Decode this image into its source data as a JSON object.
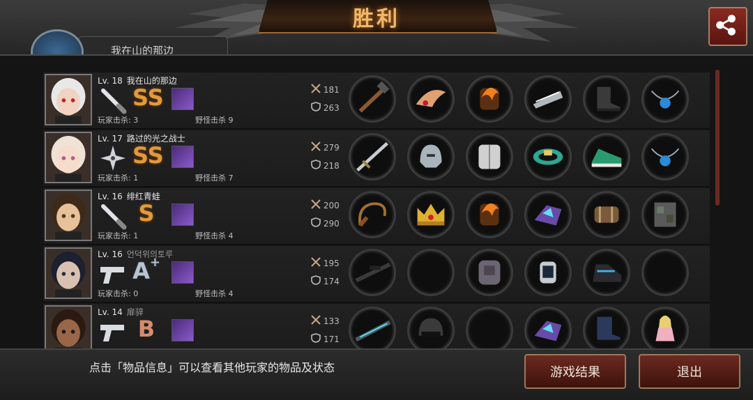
{
  "header": {
    "title": "胜利",
    "player_tab_label": "我在山的那边"
  },
  "footer": {
    "hint": "点击「物品信息」可以查看其他玩家的物品及状态",
    "result_button": "游戏结果",
    "exit_button": "退出"
  },
  "players": [
    {
      "level": "Lv. 18",
      "name": "我在山的那边",
      "grade": "SS",
      "player_kills": "玩家击杀: 3",
      "monster_kills": "野怪击杀 9",
      "attack": "181",
      "defense": "263",
      "weapon_icon": "baseball-bat-icon",
      "items": [
        "hammer",
        "wing-crown",
        "fire-armor",
        "blade-bracer",
        "boots",
        "pendant"
      ]
    },
    {
      "level": "Lv. 17",
      "name": "路过的光之战士",
      "grade": "SS",
      "player_kills": "玩家击杀: 1",
      "monster_kills": "野怪击杀 7",
      "attack": "279",
      "defense": "218",
      "weapon_icon": "shuriken-icon",
      "items": [
        "sword",
        "helmet",
        "plate-armor",
        "bracelet",
        "sneakers",
        "pendant"
      ]
    },
    {
      "level": "Lv. 16",
      "name": "绯红青蛙",
      "grade": "S",
      "player_kills": "玩家击杀: 1",
      "monster_kills": "野怪击杀 4",
      "attack": "200",
      "defense": "290",
      "weapon_icon": "baseball-bat-icon",
      "items": [
        "whip",
        "crown",
        "fire-armor",
        "crystal-gauntlet",
        "scroll-bracer",
        "ruin-block"
      ]
    },
    {
      "level": "Lv. 16",
      "name": "언덕위의토루",
      "grade": "A",
      "grade_sup": "+",
      "player_kills": "玩家击杀: 0",
      "monster_kills": "野怪击杀 4",
      "attack": "195",
      "defense": "174",
      "weapon_icon": "pistol-icon",
      "items": [
        "sniper-rifle",
        "empty",
        "dark-armor",
        "watch",
        "tech-boots",
        "empty"
      ]
    },
    {
      "level": "Lv. 14",
      "name": "扉骍",
      "grade": "B",
      "player_kills": "",
      "monster_kills": "",
      "attack": "133",
      "defense": "171",
      "weapon_icon": "pistol-icon",
      "items": [
        "laser-rifle",
        "tactical-helmet",
        "empty",
        "crystal-gauntlet",
        "combat-boots",
        "doll"
      ]
    }
  ],
  "colors": {
    "title": "#f0b86a",
    "grade_gold": "#e29a3a",
    "button_red": "#6b2a20"
  }
}
